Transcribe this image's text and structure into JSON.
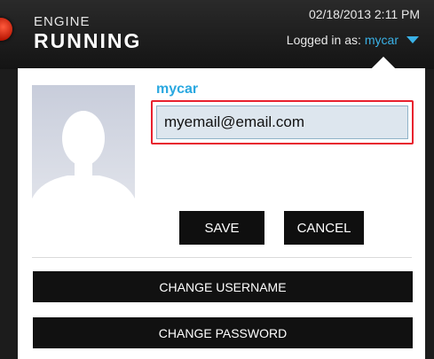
{
  "header": {
    "brand_line1": "ENGINE",
    "brand_line2": "RUNNING",
    "datetime": "02/18/2013 2:11 PM",
    "logged_in_prefix": "Logged in as:",
    "logged_in_user": "mycar"
  },
  "profile": {
    "username": "mycar",
    "email_value": "myemail@email.com"
  },
  "actions": {
    "save_label": "SAVE",
    "cancel_label": "CANCEL",
    "change_username_label": "CHANGE USERNAME",
    "change_password_label": "CHANGE PASSWORD"
  },
  "colors": {
    "accent": "#3ab1e6",
    "highlight_border": "#e8212e",
    "button_bg": "#111111"
  },
  "icons": {
    "status_indicator": "engine-running-indicator-icon",
    "dropdown_caret": "caret-down-icon",
    "avatar_placeholder": "silhouette-avatar-icon"
  }
}
